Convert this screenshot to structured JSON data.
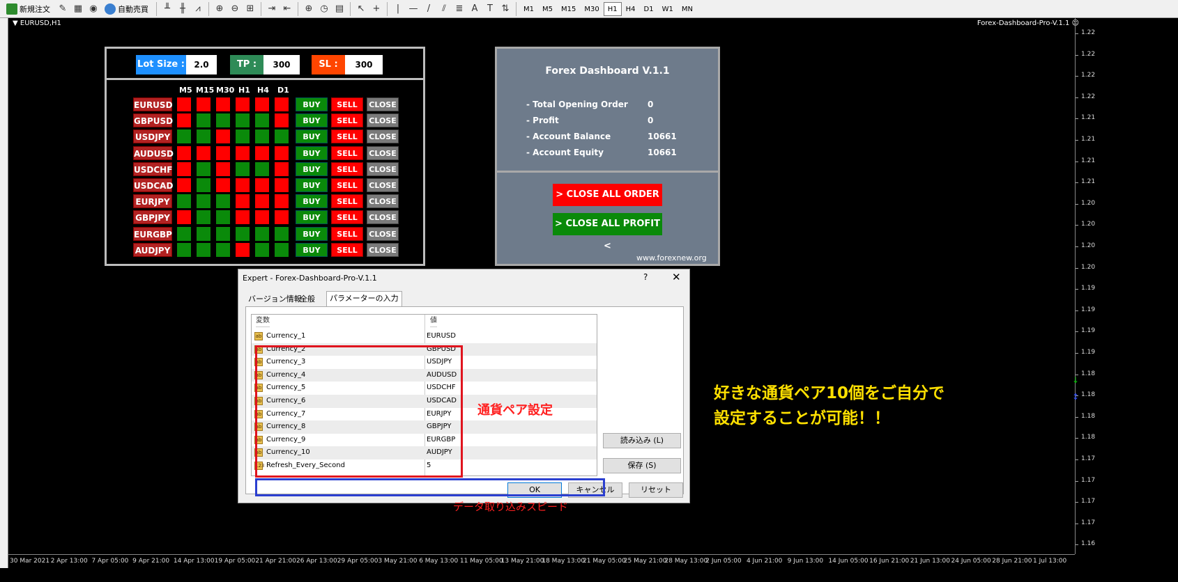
{
  "toolbar": {
    "new_order_label": "新規注文",
    "auto_trade_label": "自動売買",
    "timeframes": [
      "M1",
      "M5",
      "M15",
      "M30",
      "H1",
      "H4",
      "D1",
      "W1",
      "MN"
    ],
    "active_timeframe": "H1"
  },
  "chart": {
    "symbol_label": "EURUSD,H1",
    "ea_label": "Forex-Dashboard-Pro-V.1.1",
    "price_ticks": [
      "1.22",
      "1.22",
      "1.22",
      "1.22",
      "1.21",
      "1.21",
      "1.21",
      "1.21",
      "1.20",
      "1.20",
      "1.20",
      "1.20",
      "1.19",
      "1.19",
      "1.19",
      "1.19",
      "1.18",
      "1.18",
      "1.18",
      "1.18",
      "1.17",
      "1.17",
      "1.17",
      "1.17",
      "1.16"
    ],
    "time_ticks": [
      "30 Mar 2021",
      "2 Apr 13:00",
      "7 Apr 05:00",
      "9 Apr 21:00",
      "14 Apr 13:00",
      "19 Apr 05:00",
      "21 Apr 21:00",
      "26 Apr 13:00",
      "29 Apr 05:00",
      "3 May 21:00",
      "6 May 13:00",
      "11 May 05:00",
      "13 May 21:00",
      "18 May 13:00",
      "21 May 05:00",
      "25 May 21:00",
      "28 May 13:00",
      "2 Jun 05:00",
      "4 Jun 21:00",
      "9 Jun 13:00",
      "14 Jun 05:00",
      "16 Jun 21:00",
      "21 Jun 13:00",
      "24 Jun 05:00",
      "28 Jun 21:00",
      "1 Jul 13:00"
    ]
  },
  "dashboard": {
    "lot_label": "Lot Size :",
    "lot_value": "2.0",
    "tp_label": "TP :",
    "tp_value": "300",
    "sl_label": "SL :",
    "sl_value": "300",
    "timeframes": [
      "M5",
      "M15",
      "M30",
      "H1",
      "H4",
      "D1"
    ],
    "buy_label": "BUY",
    "sell_label": "SELL",
    "close_label": "CLOSE",
    "colors": {
      "up": "#0a8a0a",
      "down": "#ff0000"
    },
    "pairs": [
      {
        "name": "EURUSD",
        "signals": [
          "down",
          "down",
          "down",
          "down",
          "down",
          "down"
        ]
      },
      {
        "name": "GBPUSD",
        "signals": [
          "down",
          "up",
          "up",
          "up",
          "up",
          "down"
        ]
      },
      {
        "name": "USDJPY",
        "signals": [
          "up",
          "up",
          "down",
          "up",
          "up",
          "up"
        ]
      },
      {
        "name": "AUDUSD",
        "signals": [
          "down",
          "down",
          "down",
          "down",
          "down",
          "down"
        ]
      },
      {
        "name": "USDCHF",
        "signals": [
          "down",
          "up",
          "down",
          "up",
          "up",
          "down"
        ]
      },
      {
        "name": "USDCAD",
        "signals": [
          "down",
          "up",
          "down",
          "down",
          "down",
          "down"
        ]
      },
      {
        "name": "EURJPY",
        "signals": [
          "up",
          "up",
          "up",
          "down",
          "down",
          "down"
        ]
      },
      {
        "name": "GBPJPY",
        "signals": [
          "down",
          "up",
          "up",
          "down",
          "down",
          "down"
        ]
      },
      {
        "name": "EURGBP",
        "signals": [
          "up",
          "up",
          "up",
          "up",
          "up",
          "up"
        ]
      },
      {
        "name": "AUDJPY",
        "signals": [
          "up",
          "up",
          "up",
          "down",
          "up",
          "up"
        ]
      }
    ]
  },
  "info_panel": {
    "title": "Forex Dashboard V.1.1",
    "rows": [
      {
        "label": "- Total Opening Order",
        "value": "0"
      },
      {
        "label": "- Profit",
        "value": "0"
      },
      {
        "label": "- Account Balance",
        "value": "10661"
      },
      {
        "label": "- Account Equity",
        "value": "10661"
      }
    ],
    "close_all_order": "> CLOSE ALL ORDER <",
    "close_all_profit": "> CLOSE ALL PROFIT <",
    "url": "www.forexnew.org"
  },
  "dialog": {
    "title": "Expert - Forex-Dashboard-Pro-V.1.1",
    "help": "?",
    "close": "✕",
    "tabs": [
      "バージョン情報",
      "全般",
      "パラメーターの入力"
    ],
    "col_var": "変数",
    "col_val": "値",
    "params": [
      {
        "name": "Currency_1",
        "value": "EURUSD",
        "icon": "ab"
      },
      {
        "name": "Currency_2",
        "value": "GBPUSD",
        "icon": "ab"
      },
      {
        "name": "Currency_3",
        "value": "USDJPY",
        "icon": "ab"
      },
      {
        "name": "Currency_4",
        "value": "AUDUSD",
        "icon": "ab"
      },
      {
        "name": "Currency_5",
        "value": "USDCHF",
        "icon": "ab"
      },
      {
        "name": "Currency_6",
        "value": "USDCAD",
        "icon": "ab"
      },
      {
        "name": "Currency_7",
        "value": "EURJPY",
        "icon": "ab"
      },
      {
        "name": "Currency_8",
        "value": "GBPJPY",
        "icon": "ab"
      },
      {
        "name": "Currency_9",
        "value": "EURGBP",
        "icon": "ab"
      },
      {
        "name": "Currency_10",
        "value": "AUDJPY",
        "icon": "ab"
      },
      {
        "name": "Refresh_Every_Second",
        "value": "5",
        "icon": "123"
      }
    ],
    "load_btn": "読み込み (L)",
    "save_btn": "保存 (S)",
    "ok_btn": "OK",
    "cancel_btn": "キャンセル",
    "reset_btn": "リセット"
  },
  "annotations": {
    "currency_setting": "通貨ペア設定",
    "refresh_speed": "データ取り込みスピード",
    "caption_line1": "好きな通貨ペア10個をご自分で",
    "caption_line2": "設定することが可能！！"
  }
}
